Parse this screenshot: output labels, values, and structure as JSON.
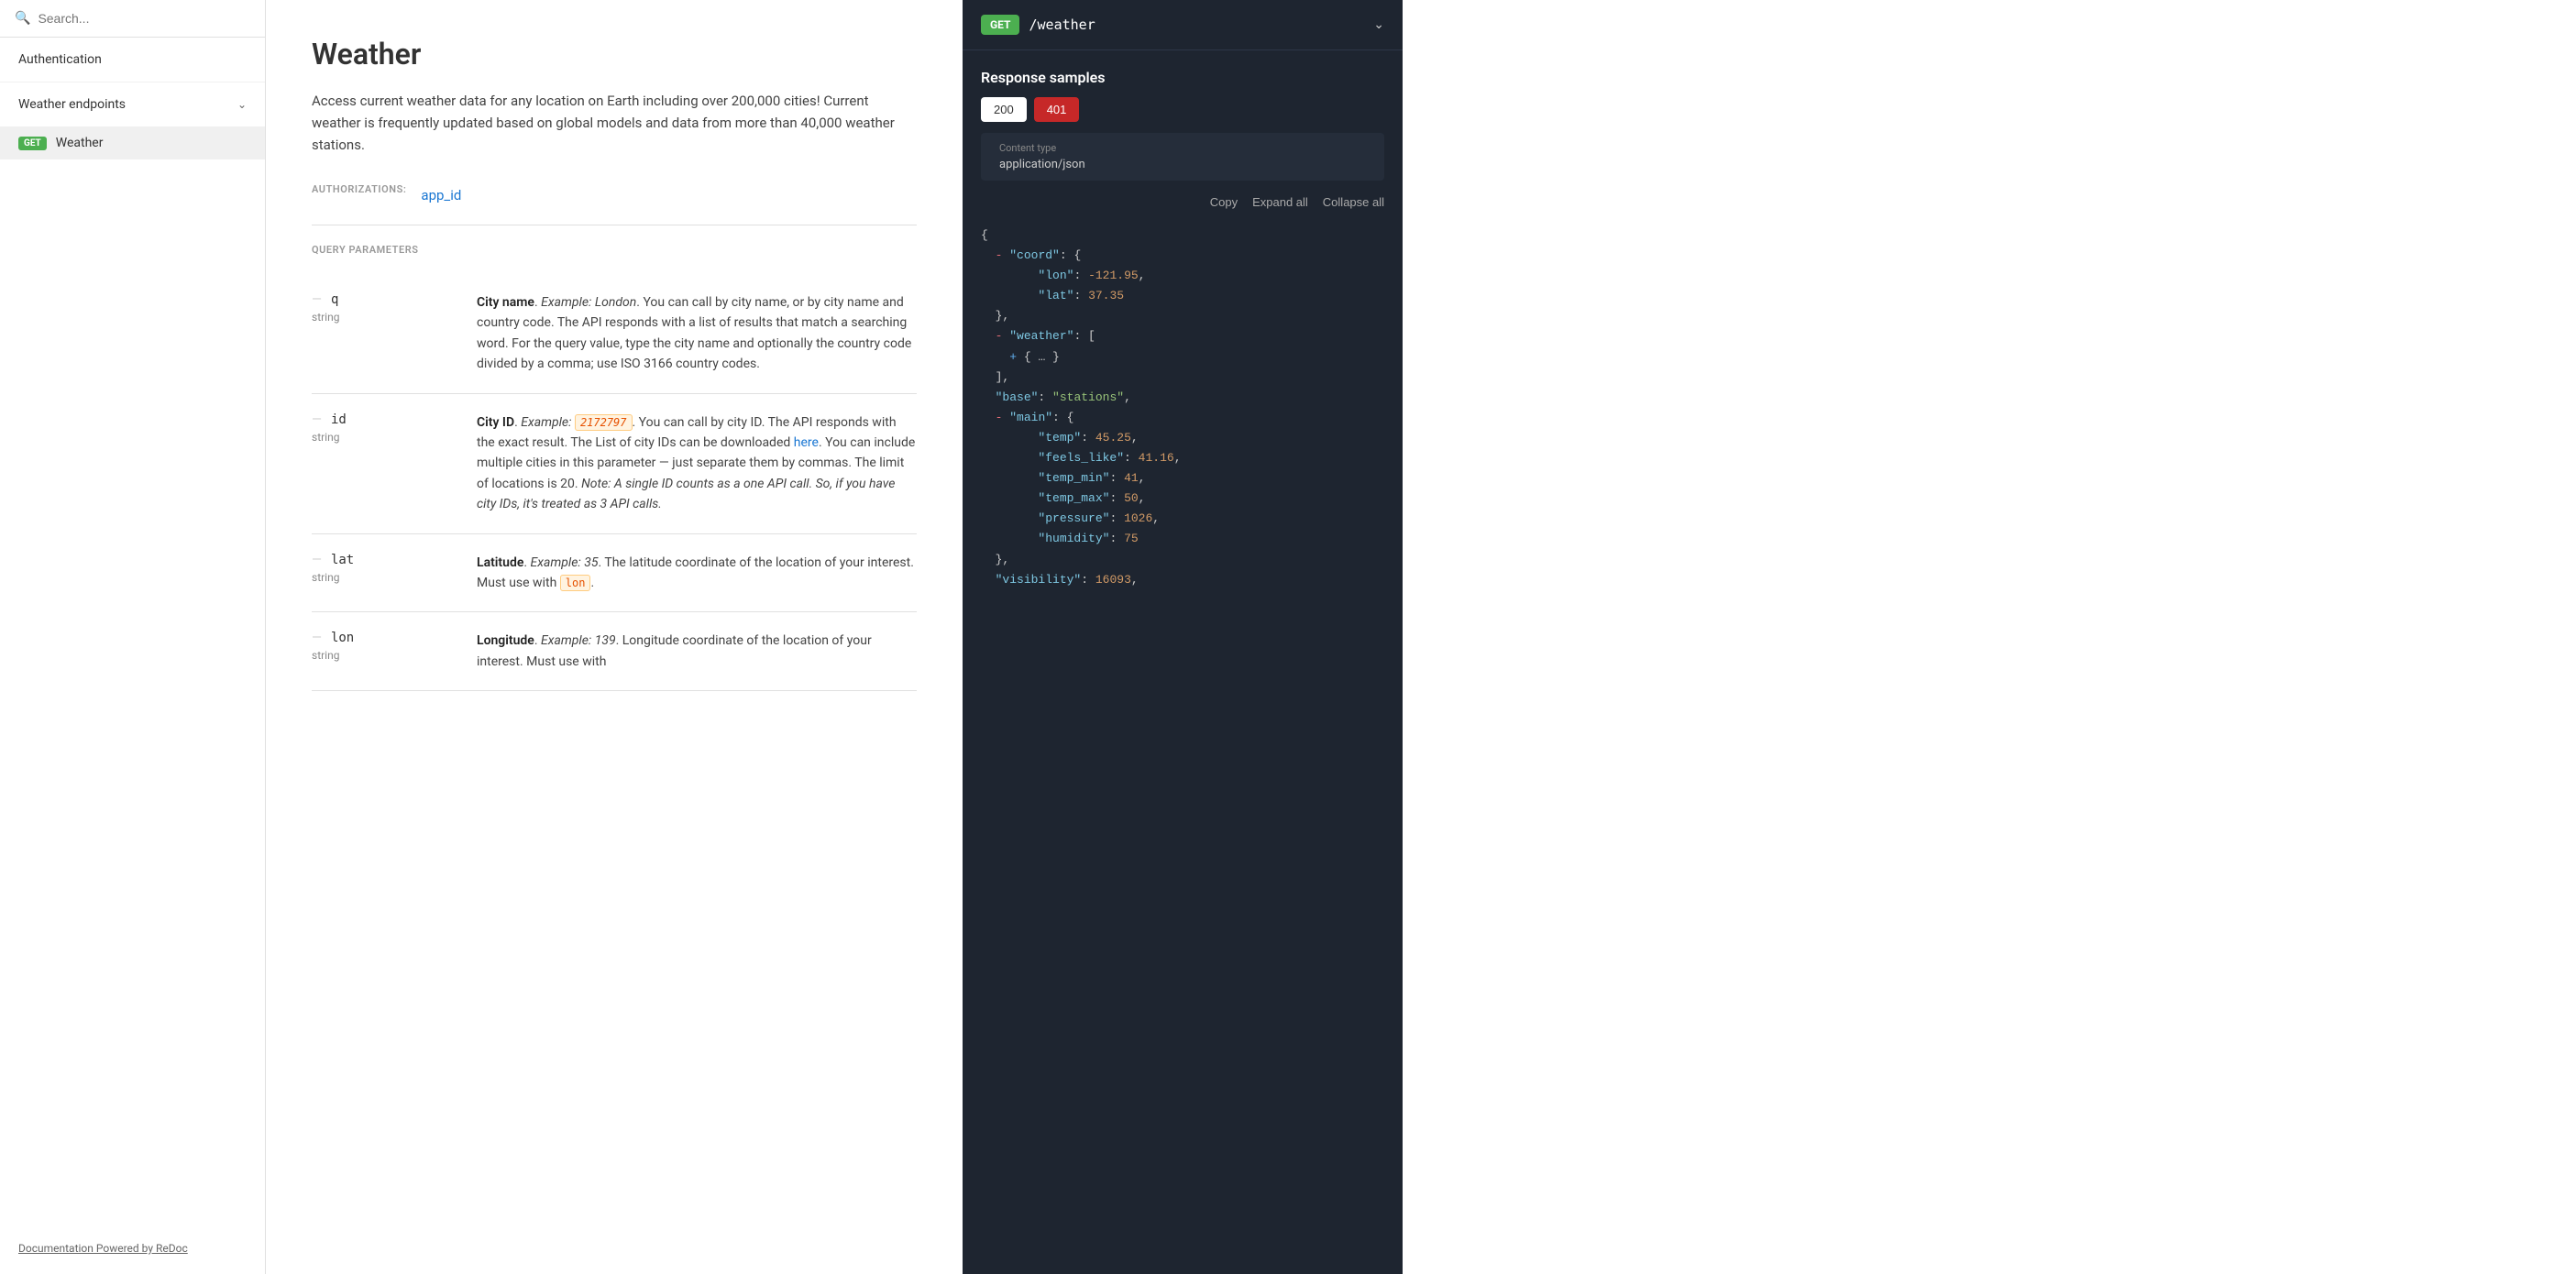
{
  "sidebar": {
    "search_placeholder": "Search...",
    "auth_label": "Authentication",
    "weather_section_label": "Weather endpoints",
    "weather_endpoint_label": "Weather",
    "redoc_link_text": "Documentation Powered by ReDoc"
  },
  "main": {
    "page_title": "Weather",
    "description": "Access current weather data for any location on Earth including over 200,000 cities! Current weather is frequently updated based on global models and data from more than 40,000 weather stations.",
    "authorizations_label": "AUTHORIZATIONS:",
    "auth_param": "app_id",
    "query_params_label": "QUERY PARAMETERS",
    "params": [
      {
        "name": "q",
        "type": "string",
        "title": "City name",
        "example_label": "Example:",
        "example_text": "London",
        "description_after": ". You can call by city name, or by city name and country code. The API responds with a list of results that match a searching word. For the query value, type the city name and optionally the country code divided by a comma; use ISO 3166 country codes."
      },
      {
        "name": "id",
        "type": "string",
        "title": "City ID",
        "example_label": "Example:",
        "example_code": "2172797",
        "description_main": ". You can call by city ID. The API responds with the exact result. The List of city IDs can be downloaded ",
        "link_text": "here",
        "description_after": ". You can include multiple cities in this parameter — just separate them by commas. The limit of locations is 20. Note: A single ID counts as a one API call. So, if you have city IDs, it's treated as 3 API calls."
      },
      {
        "name": "lat",
        "type": "string",
        "title": "Latitude",
        "example_label": "Example:",
        "example_text": "35",
        "description_main": ". The latitude coordinate of the location of your interest. Must use with ",
        "inline_code": "lon",
        "description_after": "."
      },
      {
        "name": "lon",
        "type": "string",
        "title": "Longitude",
        "example_label": "Example:",
        "example_text": "139",
        "description_main": ". Longitude coordinate of the location of your interest. Must use with "
      }
    ]
  },
  "right_panel": {
    "method": "GET",
    "path": "/weather",
    "response_samples_title": "Response samples",
    "tab_200": "200",
    "tab_401": "401",
    "content_type_label": "Content type",
    "content_type_value": "application/json",
    "actions": {
      "copy": "Copy",
      "expand_all": "Expand all",
      "collapse_all": "Collapse all"
    },
    "code": {
      "coord_lon": "-121.95",
      "coord_lat": "37.35",
      "base": "stations",
      "temp": "45.25",
      "feels_like": "41.16",
      "temp_min": "41",
      "temp_max": "50",
      "pressure": "1026",
      "humidity": "75",
      "visibility": "16093"
    }
  }
}
